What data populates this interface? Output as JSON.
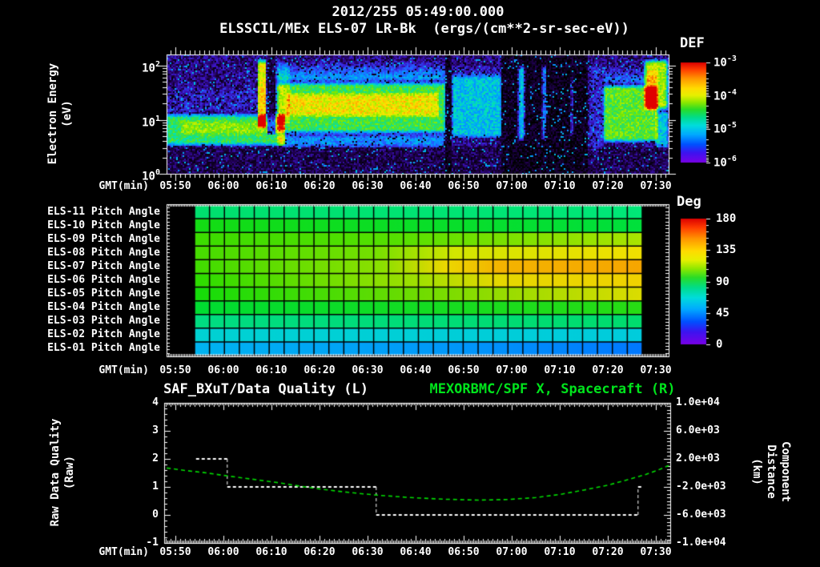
{
  "header": {
    "datetime": "2012/255 05:49:00.000",
    "instrument_title": "ELSSCIL/MEx ELS-07 LR-Bk  (ergs/(cm**2-sr-sec-eV))"
  },
  "colors": {
    "background": "#000000",
    "text": "#ffffff",
    "frame": "#ffffff",
    "title_green": "#00e41c",
    "curve_green": "#00dd00",
    "quality_white": "#ffffff"
  },
  "chart_data": [
    {
      "type": "heatmap",
      "name": "electron-energy-spectrogram",
      "ylabel": "Electron Energy\n(eV)",
      "xlabel": "GMT(min)",
      "x_ticks": [
        "05:50",
        "06:00",
        "06:10",
        "06:20",
        "06:30",
        "06:40",
        "06:50",
        "07:00",
        "07:10",
        "07:20",
        "07:30"
      ],
      "x_range_gmt": [
        "05:49",
        "07:32"
      ],
      "y_ticks": [
        {
          "base": "10",
          "exp": "2",
          "value": 100
        },
        {
          "base": "10",
          "exp": "1",
          "value": 10
        },
        {
          "base": "10",
          "exp": "0",
          "value": 1
        }
      ],
      "y_range_ev": [
        1,
        160
      ],
      "colorbar": {
        "label": "DEF",
        "units": "ergs/(cm**2-sr-sec-eV)",
        "ticks": [
          {
            "base": "10",
            "exp": "-3"
          },
          {
            "base": "10",
            "exp": "-4"
          },
          {
            "base": "10",
            "exp": "-5"
          },
          {
            "base": "10",
            "exp": "-6"
          }
        ]
      },
      "palette": [
        [
          0,
          "#000000"
        ],
        [
          0.1,
          "#200050"
        ],
        [
          0.2,
          "#3c14c8"
        ],
        [
          0.3,
          "#2855ff"
        ],
        [
          0.4,
          "#00a0ff"
        ],
        [
          0.5,
          "#00e0c0"
        ],
        [
          0.58,
          "#28e060"
        ],
        [
          0.66,
          "#78e800"
        ],
        [
          0.74,
          "#ccf000"
        ],
        [
          0.8,
          "#ffe400"
        ],
        [
          0.88,
          "#ff9600"
        ],
        [
          1,
          "#e00000"
        ]
      ],
      "noise": {
        "base_high": 0.15,
        "base_low": 0.1,
        "low_split_ev": 3,
        "amp": 0.16,
        "seed": 123457
      },
      "features": [
        {
          "t0": 348,
          "t1": 373,
          "e0": 3.2,
          "e1": 13,
          "v": 0.42
        },
        {
          "t0": 351,
          "t1": 371,
          "e0": 5,
          "e1": 10,
          "v": 0.1
        },
        {
          "t0": 348,
          "t1": 370,
          "e0": 13,
          "e1": 40,
          "v": 0.06
        },
        {
          "t0": 367.1,
          "t1": 369,
          "e0": 7,
          "e1": 130,
          "v": 0.62,
          "soft_t": 0.3
        },
        {
          "t0": 369.2,
          "t1": 370.9,
          "e0": 5.5,
          "e1": 160,
          "mult": 0.45
        },
        {
          "t0": 371,
          "t1": 406.3,
          "e0": 5.5,
          "e1": 50,
          "v": 0.45
        },
        {
          "t0": 373,
          "t1": 405,
          "e0": 11,
          "e1": 32,
          "v": 0.18
        },
        {
          "t0": 371,
          "t1": 406.3,
          "e0": 50,
          "e1": 130,
          "v": 0.3,
          "fade": "up"
        },
        {
          "t0": 371,
          "t1": 406.3,
          "e0": 3,
          "e1": 5.5,
          "v": 0.22
        },
        {
          "t0": 371,
          "t1": 374,
          "e0": 8,
          "e1": 120,
          "v": 0.12
        },
        {
          "t0": 406.3,
          "t1": 407.5,
          "e0": 1,
          "e1": 160,
          "mult": 0.3
        },
        {
          "t0": 407.5,
          "t1": 418,
          "e0": 4.5,
          "e1": 70,
          "v": 0.3
        },
        {
          "t0": 407.5,
          "t1": 418,
          "e0": 70,
          "e1": 110,
          "v": 0.12,
          "fade": "up"
        },
        {
          "t0": 418,
          "t1": 429,
          "e0": 1,
          "e1": 160,
          "mult": 0.22
        },
        {
          "t0": 421.3,
          "t1": 422.8,
          "e0": 4,
          "e1": 100,
          "v": 0.42
        },
        {
          "t0": 426.3,
          "t1": 427.3,
          "e0": 4,
          "e1": 100,
          "v": 0.38
        },
        {
          "t0": 429,
          "t1": 436,
          "e0": 1,
          "e1": 160,
          "mult": 0.18
        },
        {
          "t0": 432.2,
          "t1": 432.8,
          "e0": 5,
          "e1": 60,
          "v": 0.35
        },
        {
          "t0": 436,
          "t1": 439,
          "e0": 2.5,
          "e1": 100,
          "v": 0.08
        },
        {
          "t0": 439,
          "t1": 450.5,
          "e0": 3.8,
          "e1": 45,
          "v": 0.48
        },
        {
          "t0": 439,
          "t1": 450.5,
          "e0": 45,
          "e1": 110,
          "v": 0.22,
          "fade": "up"
        },
        {
          "t0": 447.5,
          "t1": 452.7,
          "e0": 15,
          "e1": 130,
          "v": 0.55,
          "soft_t": 0.8
        },
        {
          "t0": 450,
          "t1": 452.7,
          "e0": 3,
          "e1": 15,
          "v": 0.3
        }
      ]
    },
    {
      "type": "heatmap-grid",
      "name": "pitch-angle-panel",
      "xlabel": "GMT(min)",
      "x_ticks": [
        "05:50",
        "06:00",
        "06:10",
        "06:20",
        "06:30",
        "06:40",
        "06:50",
        "07:00",
        "07:10",
        "07:20",
        "07:30"
      ],
      "data_time_range": [
        "05:54",
        "07:26"
      ],
      "columns": 30,
      "colorbar": {
        "label": "Deg",
        "ticks": [
          "180",
          "135",
          "90",
          "45",
          "0"
        ],
        "tick_values": [
          180,
          135,
          90,
          45,
          0
        ]
      },
      "rows": [
        {
          "label": "ELS-11 Pitch Angle",
          "stops": [
            [
              0,
              "#00e06e"
            ],
            [
              1,
              "#00e878"
            ]
          ]
        },
        {
          "label": "ELS-10 Pitch Angle",
          "stops": [
            [
              0,
              "#14dc14"
            ],
            [
              1,
              "#00e03c"
            ]
          ]
        },
        {
          "label": "ELS-09 Pitch Angle",
          "stops": [
            [
              0,
              "#3cdc00"
            ],
            [
              0.45,
              "#55e000"
            ],
            [
              1,
              "#aae400"
            ]
          ]
        },
        {
          "label": "ELS-08 Pitch Angle",
          "stops": [
            [
              0,
              "#46dc00"
            ],
            [
              0.4,
              "#74e000"
            ],
            [
              0.58,
              "#d2e600"
            ],
            [
              1,
              "#f0e000"
            ]
          ]
        },
        {
          "label": "ELS-07 Pitch Angle",
          "stops": [
            [
              0,
              "#40dc00"
            ],
            [
              0.42,
              "#8ce000"
            ],
            [
              0.56,
              "#ecd800"
            ],
            [
              0.68,
              "#f4b400"
            ],
            [
              1,
              "#f6a600"
            ]
          ]
        },
        {
          "label": "ELS-06 Pitch Angle",
          "stops": [
            [
              0,
              "#2cdc00"
            ],
            [
              0.5,
              "#a0e000"
            ],
            [
              0.68,
              "#e6d800"
            ],
            [
              1,
              "#f0d200"
            ]
          ]
        },
        {
          "label": "ELS-05 Pitch Angle",
          "stops": [
            [
              0,
              "#14dc0a"
            ],
            [
              0.55,
              "#78dc00"
            ],
            [
              1,
              "#dcdc00"
            ]
          ]
        },
        {
          "label": "ELS-04 Pitch Angle",
          "stops": [
            [
              0,
              "#00dc32"
            ],
            [
              1,
              "#28dc14"
            ]
          ]
        },
        {
          "label": "ELS-03 Pitch Angle",
          "stops": [
            [
              0,
              "#00dc82"
            ],
            [
              1,
              "#00dc6e"
            ]
          ]
        },
        {
          "label": "ELS-02 Pitch Angle",
          "stops": [
            [
              0,
              "#00d2d2"
            ],
            [
              1,
              "#00ccdc"
            ]
          ]
        },
        {
          "label": "ELS-01 Pitch Angle",
          "stops": [
            [
              0,
              "#00b4f0"
            ],
            [
              0.6,
              "#0096fa"
            ],
            [
              1,
              "#0078ff"
            ]
          ]
        }
      ]
    },
    {
      "type": "line",
      "name": "data-quality-and-distance",
      "title_left": "SAF_BXuT/Data Quality (L)",
      "title_right": "MEXORBMC/SPF X, Spacecraft (R)",
      "ylabel_left": "Raw Data Quality\n(Raw)",
      "ylabel_right": "Component Distance\n(km)",
      "xlabel": "GMT(min)",
      "x_ticks": [
        "05:50",
        "06:00",
        "06:10",
        "06:20",
        "06:30",
        "06:40",
        "06:50",
        "07:00",
        "07:10",
        "07:20",
        "07:30"
      ],
      "yticks_left": [
        "4",
        "3",
        "2",
        "1",
        "0",
        "-1"
      ],
      "yticks_left_values": [
        4,
        3,
        2,
        1,
        0,
        -1
      ],
      "ylim_left": [
        -1,
        4
      ],
      "yticks_right": [
        "1.0e+04",
        "6.0e+03",
        "2.0e+03",
        "-2.0e+03",
        "-6.0e+03",
        "-1.0e+04"
      ],
      "yticks_right_values": [
        10000,
        6000,
        2000,
        -2000,
        -6000,
        -10000
      ],
      "ylim_right": [
        -10000,
        10000
      ],
      "quality_segments": [
        {
          "t0": 354.3,
          "t1": 360.8,
          "value": 2
        },
        {
          "t0": 360.8,
          "t1": 391.8,
          "value": 1
        },
        {
          "t0": 391.8,
          "t1": 446.3,
          "value": 0
        },
        {
          "t0": 446.3,
          "t1": 447.3,
          "value": 1
        }
      ],
      "distance_curve": [
        [
          348.2,
          700
        ],
        [
          352,
          350
        ],
        [
          356,
          40
        ],
        [
          360,
          -350
        ],
        [
          364,
          -720
        ],
        [
          368,
          -1080
        ],
        [
          372,
          -1450
        ],
        [
          376,
          -1900
        ],
        [
          381,
          -2380
        ],
        [
          386,
          -2780
        ],
        [
          392,
          -3180
        ],
        [
          399,
          -3520
        ],
        [
          406,
          -3760
        ],
        [
          413,
          -3880
        ],
        [
          419,
          -3800
        ],
        [
          425,
          -3520
        ],
        [
          430,
          -3080
        ],
        [
          435,
          -2450
        ],
        [
          440,
          -1750
        ],
        [
          444,
          -1000
        ],
        [
          448,
          -200
        ],
        [
          450.5,
          420
        ],
        [
          452.7,
          1060
        ]
      ]
    }
  ],
  "colorbar_palette": [
    [
      0,
      "#dc0000"
    ],
    [
      0.07,
      "#ff3c00"
    ],
    [
      0.16,
      "#ff9600"
    ],
    [
      0.26,
      "#ffdc00"
    ],
    [
      0.33,
      "#e6f000"
    ],
    [
      0.4,
      "#8ce800"
    ],
    [
      0.47,
      "#28dc28"
    ],
    [
      0.55,
      "#00dc8c"
    ],
    [
      0.63,
      "#00dcdc"
    ],
    [
      0.72,
      "#00aaff"
    ],
    [
      0.82,
      "#0050ff"
    ],
    [
      0.9,
      "#3c14f0"
    ],
    [
      1,
      "#7800e6"
    ]
  ]
}
